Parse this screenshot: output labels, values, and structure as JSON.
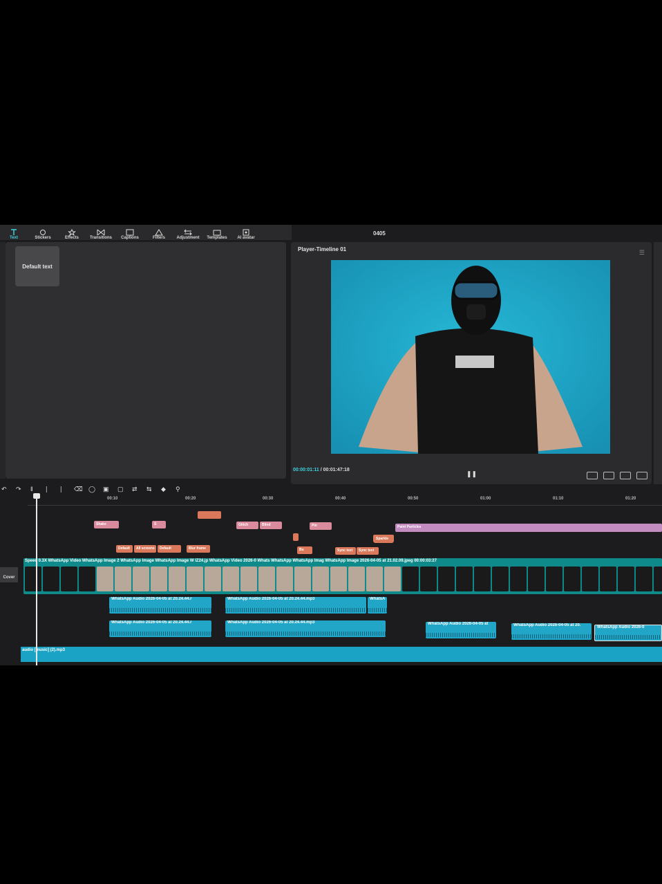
{
  "window": {
    "title": "0405"
  },
  "toolbar": {
    "items": [
      {
        "label": "Text",
        "icon": "text-icon",
        "active": true
      },
      {
        "label": "Stickers",
        "icon": "sticker-icon"
      },
      {
        "label": "Effects",
        "icon": "effects-icon"
      },
      {
        "label": "Transitions",
        "icon": "transitions-icon"
      },
      {
        "label": "Captions",
        "icon": "captions-icon"
      },
      {
        "label": "Filters",
        "icon": "filters-icon"
      },
      {
        "label": "Adjustment",
        "icon": "adjustment-icon"
      },
      {
        "label": "Templates",
        "icon": "templates-icon"
      },
      {
        "label": "AI avatar",
        "icon": "ai-avatar-icon"
      }
    ]
  },
  "left_panel": {
    "default_text_label": "Default text"
  },
  "player": {
    "title": "Player-Timeline 01",
    "current_time": "00:00:01:11",
    "duration": "00:01:47:18",
    "accent": "#3fd3e0"
  },
  "ruler": {
    "ticks": [
      "00:10",
      "00:20",
      "00:30",
      "00:40",
      "00:50",
      "01:00",
      "01:10",
      "01:20"
    ]
  },
  "timeline": {
    "clip_rows": {
      "row1": [
        {
          "label": "Shake"
        },
        {
          "label": "S"
        },
        {
          "label": "Glitch"
        },
        {
          "label": "Blind"
        },
        {
          "label": "Pin"
        },
        {
          "label": "Paint Particles"
        }
      ],
      "row2": [
        {
          "label": "Default"
        },
        {
          "label": "All screens"
        },
        {
          "label": "Default"
        },
        {
          "label": "Blur frame"
        },
        {
          "label": "Bu"
        },
        {
          "label": "Sync text"
        },
        {
          "label": "Sync text"
        },
        {
          "label": "Sparkle"
        }
      ]
    },
    "video_track_label": "Speed 0.3X  WhatsApp Video  WhatsApp Image 2  WhatsApp Image  WhatsApp Image  W  IZ24.jp  WhatsApp Video 2026-0  Whats  WhatsApp  WhatsApp Imag  WhatsApp Image 2026-04-05 at 21.02.09.jpeg  00:00:03:27",
    "cover_label": "Cover",
    "audio_clips": [
      {
        "label": "WhatsApp Audio 2026-04-05 at 20.24.44.r"
      },
      {
        "label": "WhatsApp Audio 2026-04-05 at 20.24.44.mp3"
      },
      {
        "label": "WhatsA"
      },
      {
        "label": "WhatsApp Audio 2026-04-05 at 20.24.44.r"
      },
      {
        "label": "WhatsApp Audio 2026-04-05 at 20.24.44.mp3"
      },
      {
        "label": "WhatsApp Audio 2026-04-05 at"
      },
      {
        "label": "WhatsApp Audio 2026-04-05 at 20."
      },
      {
        "label": "WhatsApp Audio 2026-0"
      }
    ],
    "music_label": "audio [music] (2).mp3"
  }
}
